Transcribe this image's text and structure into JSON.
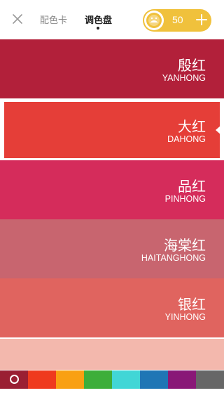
{
  "header": {
    "tabs": [
      {
        "label": "配色卡",
        "active": false
      },
      {
        "label": "调色盘",
        "active": true
      }
    ],
    "coins": "50",
    "coin_pill_color": "#f0c13c",
    "icons": [
      "close-icon",
      "coin-face-icon",
      "plus-icon"
    ]
  },
  "colors": [
    {
      "name": "殷红",
      "pinyin": "YANHONG",
      "hex": "#b2203a",
      "selected": false
    },
    {
      "name": "大红",
      "pinyin": "DAHONG",
      "hex": "#e53e38",
      "selected": true
    },
    {
      "name": "品红",
      "pinyin": "PINHONG",
      "hex": "#d52c5b",
      "selected": false
    },
    {
      "name": "海棠红",
      "pinyin": "HAITANGHONG",
      "hex": "#c8656f",
      "selected": false
    },
    {
      "name": "银红",
      "pinyin": "YINHONG",
      "hex": "#e0645f",
      "selected": false
    },
    {
      "name": "",
      "pinyin": "",
      "hex": "#f3b8ad",
      "selected": false
    }
  ],
  "swatches": [
    {
      "hex": "#9a1f33",
      "active": true
    },
    {
      "hex": "#ef3a1e",
      "active": false
    },
    {
      "hex": "#f9a012",
      "active": false
    },
    {
      "hex": "#3dae3a",
      "active": false
    },
    {
      "hex": "#41d6d6",
      "active": false
    },
    {
      "hex": "#1f76b5",
      "active": false
    },
    {
      "hex": "#891877",
      "active": false
    },
    {
      "hex": "#676767",
      "active": false
    }
  ]
}
